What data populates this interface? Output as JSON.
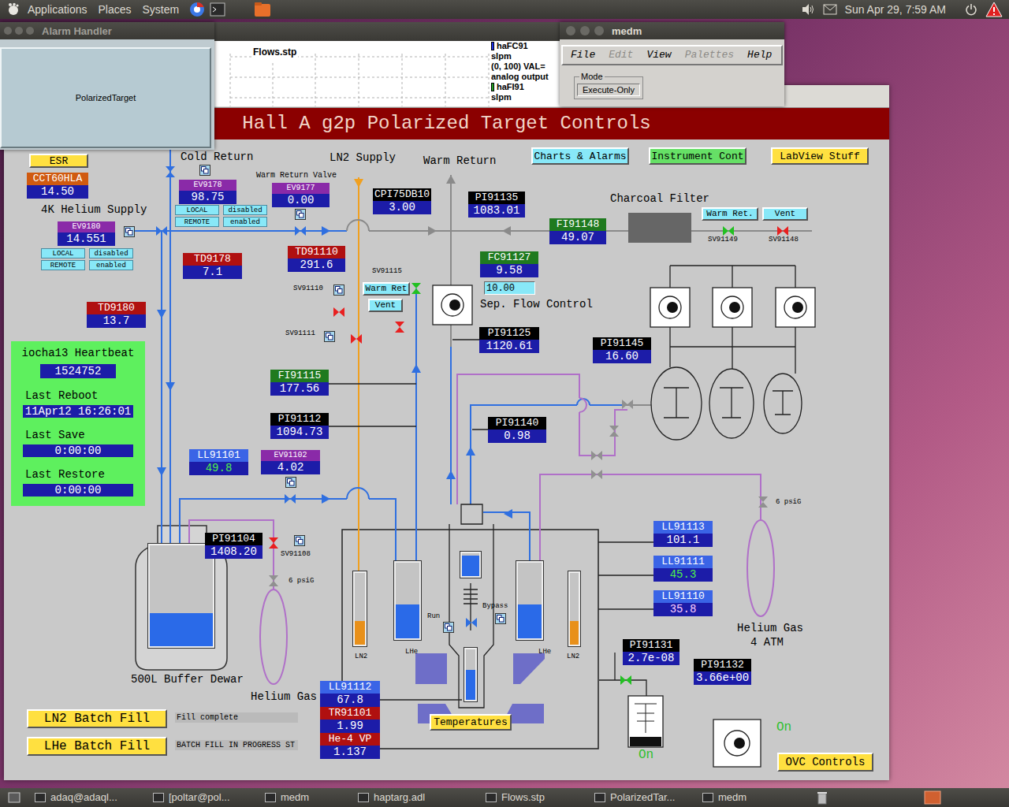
{
  "top_panel": {
    "menus": [
      "Applications",
      "Places",
      "System"
    ],
    "clock": "Sun Apr 29, 7:59 AM"
  },
  "alarm_handler": {
    "title": "Alarm Handler",
    "group": "PolarizedTarget"
  },
  "flows_window": {
    "chart_title": "Flows.stp",
    "legend": [
      {
        "text": "haFC91",
        "kind": "name",
        "color": "#1a2ee8"
      },
      {
        "text": "slpm",
        "kind": "info"
      },
      {
        "text": "(0, 100) VAL=",
        "kind": "info"
      },
      {
        "text": "analog output",
        "kind": "info"
      },
      {
        "text": "haFI91",
        "kind": "name",
        "color": "#22a022"
      },
      {
        "text": "slpm",
        "kind": "info"
      }
    ]
  },
  "medm_window": {
    "title": "medm",
    "menus": [
      {
        "label": "File",
        "disabled": false
      },
      {
        "label": "Edit",
        "disabled": true
      },
      {
        "label": "View",
        "disabled": false
      },
      {
        "label": "Palettes",
        "disabled": true
      },
      {
        "label": "Help",
        "disabled": false
      }
    ],
    "mode_label": "Mode",
    "mode": "Execute-Only"
  },
  "display": {
    "title": "Hall A g2p Polarized Target Controls",
    "buttons": [
      {
        "label": "Charts & Alarms",
        "color": "#88e8f8"
      },
      {
        "label": "Instrument Cont",
        "color": "#66e066"
      },
      {
        "label": "LabView Stuff",
        "color": "#ffe040"
      },
      {
        "label": "ESR",
        "color": "#ffe040"
      },
      {
        "label": "Warm Ret.",
        "color": "#88e8f8"
      },
      {
        "label": "Vent",
        "color": "#88e8f8"
      },
      {
        "label": "Warm Ret",
        "color": "#88e8f8"
      },
      {
        "label": "Vent",
        "color": "#88e8f8"
      },
      {
        "label": "Temperatures",
        "color": "#ffe040"
      },
      {
        "label": "OVC Controls",
        "color": "#ffe040"
      }
    ],
    "readouts": [
      {
        "tag": "CCT60HLA",
        "value": "14.50",
        "kind": "sensor",
        "color": "#d05a10",
        "value_color": "#ffffff"
      },
      {
        "tag": "EV9178",
        "value": "98.75",
        "kind": "valve",
        "color": "#8a2aa8",
        "value_color": "#ffffff"
      },
      {
        "tag": "EV9177",
        "value": "0.00",
        "kind": "valve",
        "color": "#8a2aa8",
        "value_color": "#ffffff"
      },
      {
        "tag": "EV9180",
        "value": "14.551",
        "kind": "valve",
        "color": "#8a2aa8",
        "value_color": "#ffffff"
      },
      {
        "tag": "TD9178",
        "value": "7.1",
        "kind": "sensor",
        "color": "#b01010",
        "value_color": "#ffffff"
      },
      {
        "tag": "TD91110",
        "value": "291.6",
        "kind": "sensor",
        "color": "#b01010",
        "value_color": "#ffffff"
      },
      {
        "tag": "TD9180",
        "value": "13.7",
        "kind": "sensor",
        "color": "#b01010",
        "value_color": "#ffffff"
      },
      {
        "tag": "CPI75DB10",
        "value": "3.00",
        "kind": "sensor",
        "color": "#000000",
        "value_color": "#ffffff"
      },
      {
        "tag": "PI91135",
        "value": "1083.01",
        "kind": "sensor",
        "color": "#000000",
        "value_color": "#ffffff"
      },
      {
        "tag": "FI91148",
        "value": "49.07",
        "kind": "sensor",
        "color": "#1f7a1f",
        "value_color": "#ffffff"
      },
      {
        "tag": "FC91127",
        "value": "9.58",
        "kind": "sensor",
        "color": "#1f7a1f",
        "value_color": "#ffffff"
      },
      {
        "tag": "PI91125",
        "value": "1120.61",
        "kind": "sensor",
        "color": "#000000",
        "value_color": "#ffffff"
      },
      {
        "tag": "PI91145",
        "value": "16.60",
        "kind": "sensor",
        "color": "#000000",
        "value_color": "#ffffff"
      },
      {
        "tag": "FI91115",
        "value": "177.56",
        "kind": "sensor",
        "color": "#1f7a1f",
        "value_color": "#ffffff"
      },
      {
        "tag": "PI91112",
        "value": "1094.73",
        "kind": "sensor",
        "color": "#000000",
        "value_color": "#ffffff"
      },
      {
        "tag": "PI91140",
        "value": "0.98",
        "kind": "sensor",
        "color": "#000000",
        "value_color": "#ffffff"
      },
      {
        "tag": "LL91101",
        "value": "49.8",
        "kind": "sensor",
        "color": "#3a64e6",
        "value_color": "#4cf04c"
      },
      {
        "tag": "EV91102",
        "value": "4.02",
        "kind": "valve",
        "color": "#8a2aa8",
        "value_color": "#ffffff"
      },
      {
        "tag": "PI91104",
        "value": "1408.20",
        "kind": "sensor",
        "color": "#000000",
        "value_color": "#ffffff"
      },
      {
        "tag": "LL91113",
        "value": "101.1",
        "kind": "sensor",
        "color": "#3a64e6",
        "value_color": "#ffffff"
      },
      {
        "tag": "LL91111",
        "value": "45.3",
        "kind": "sensor",
        "color": "#3a64e6",
        "value_color": "#4cf04c"
      },
      {
        "tag": "LL91110",
        "value": "35.8",
        "kind": "sensor",
        "color": "#3a64e6",
        "value_color": "#ffd0ff"
      },
      {
        "tag": "PI91131",
        "value": "2.7e-08",
        "kind": "sensor",
        "color": "#000000",
        "value_color": "#ffffff"
      },
      {
        "tag": "PI91132",
        "value": "3.66e+00",
        "kind": "sensor",
        "color": "#000000",
        "value_color": "#ffffff"
      },
      {
        "tag": "LL91112",
        "value": "67.8",
        "kind": "sensor",
        "color": "#3a64e6",
        "value_color": "#ffffff"
      },
      {
        "tag": "TR91101",
        "value": "1.99",
        "kind": "sensor",
        "color": "#b01010",
        "value_color": "#ffffff"
      },
      {
        "tag": "He-4 VP",
        "value": "1.137",
        "kind": "sensor",
        "color": "#b01010",
        "value_color": "#ffffff"
      }
    ],
    "mode_switches": [
      {
        "local": "LOCAL",
        "local_state": "disabled",
        "remote": "REMOTE",
        "remote_state": "enabled"
      },
      {
        "local": "LOCAL",
        "local_state": "disabled",
        "remote": "REMOTE",
        "remote_state": "enabled"
      }
    ],
    "setpoint": "10.00",
    "labels": [
      "4K Helium Supply",
      "Cold Return",
      "Warm Return Valve",
      "LN2 Supply",
      "Warm Return",
      "Charcoal Filter",
      "Sep. Flow Control",
      "SV91115",
      "SV91110",
      "SV91111",
      "SV91149",
      "SV91148",
      "SV91108",
      "6 psiG",
      "6 psiG",
      "500L Buffer Dewar",
      "Helium Gas",
      "Helium Gas",
      "4 ATM",
      "LN2",
      "LHe",
      "LHe",
      "LN2",
      "Run",
      "Bypass"
    ],
    "valves": [
      {
        "color": "#2f6fe0"
      },
      {
        "color": "#2f6fe0"
      },
      {
        "color": "#2f6fe0"
      },
      {
        "color": "#e82020"
      },
      {
        "color": "#e82020"
      },
      {
        "color": "#22c022"
      },
      {
        "color": "#e82020"
      },
      {
        "color": "#22c022"
      },
      {
        "color": "#e82020"
      },
      {
        "color": "#e82020"
      },
      {
        "color": "#909090"
      },
      {
        "color": "#2f6fe0"
      },
      {
        "color": "#909090"
      },
      {
        "color": "#909090"
      },
      {
        "color": "#909090"
      },
      {
        "color": "#909090"
      },
      {
        "color": "#909090"
      },
      {
        "color": "#22c022"
      },
      {
        "color": "#2f6fe0"
      }
    ],
    "vessels": [
      {
        "level": 0.33,
        "color": "#2a6ae8"
      },
      {
        "level": 0.33,
        "color": "#e8901a"
      },
      {
        "level": 0.45,
        "color": "#2a6ae8"
      },
      {
        "level": 0.9,
        "color": "#2a6ae8"
      },
      {
        "level": 0.6,
        "color": "#2a6ae8"
      },
      {
        "level": 0.45,
        "color": "#2a6ae8"
      },
      {
        "level": 0.33,
        "color": "#e8901a"
      }
    ],
    "pump_status": [
      {
        "text": "On",
        "color": "#2ec02e"
      },
      {
        "text": "On",
        "color": "#2ec02e"
      }
    ],
    "heartbeat": {
      "title": "iocha13 Heartbeat",
      "count": "1524752",
      "rows": [
        {
          "label": "Last Reboot",
          "value": "11Apr12 16:26:01"
        },
        {
          "label": "Last Save",
          "value": "0:00:00"
        },
        {
          "label": "Last Restore",
          "value": "0:00:00"
        }
      ]
    },
    "batch_fills": [
      {
        "label": "LN2 Batch Fill",
        "status": "Fill complete"
      },
      {
        "label": "LHe Batch Fill",
        "status": "BATCH FILL IN PROGRESS ST"
      }
    ]
  },
  "taskbar": {
    "items": [
      "adaq@adaql...",
      "[poltar@pol...",
      "medm",
      "haptarg.adl",
      "Flows.stp",
      "PolarizedTar...",
      "medm"
    ]
  }
}
